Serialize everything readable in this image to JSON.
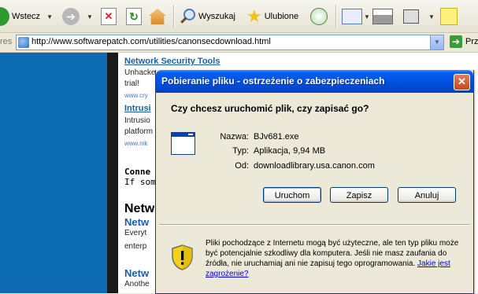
{
  "toolbar": {
    "back_label": "Wstecz",
    "search_label": "Wyszukaj",
    "favorites_label": "Ulubione"
  },
  "address": {
    "label": "res",
    "url": "http://www.softwarepatch.com/utilities/canonsecdownload.html",
    "go_label": "Przejdź"
  },
  "page": {
    "link1": "Network Security Tools",
    "text1a": "Unhacke",
    "text1b": "trial!",
    "url1": "www.cry",
    "link2": "Intrusi",
    "text2a": "Intrusio",
    "text2b": "platform",
    "url2": "www.nik",
    "mono1": "Conne",
    "mono2": "If som",
    "heading1": "Netw",
    "sub1": "Netw",
    "text3a": "Everyt",
    "text3b": "enterp",
    "sub2": "Netw",
    "text4": "Anothe"
  },
  "dialog": {
    "title": "Pobieranie pliku - ostrzeżenie o zabezpieczeniach",
    "question": "Czy chcesz uruchomić plik, czy zapisać go?",
    "name_label": "Nazwa:",
    "name_value": "BJv681.exe",
    "type_label": "Typ:",
    "type_value": "Aplikacja, 9,94 MB",
    "from_label": "Od:",
    "from_value": "downloadlibrary.usa.canon.com",
    "run_button": "Uruchom",
    "save_button": "Zapisz",
    "cancel_button": "Anuluj",
    "warning_text": "Pliki pochodzące z Internetu mogą być użyteczne, ale ten typ pliku może być potencjalnie szkodliwy dla komputera. Jeśli nie masz zaufania do źródła, nie uruchamiaj ani nie zapisuj tego oprogramowania.",
    "warning_link": "Jakie jest zagrożenie?"
  },
  "colors": {
    "titlebar": "#0054e3",
    "page_blue": "#0c6bb3",
    "link": "#1a5fa8"
  }
}
